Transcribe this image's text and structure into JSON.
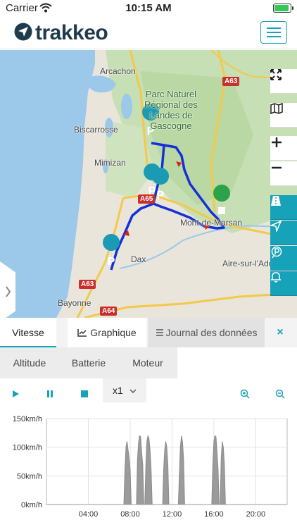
{
  "status_bar": {
    "carrier": "Carrier",
    "time": "10:15 AM"
  },
  "header": {
    "brand": "trakkeo"
  },
  "map": {
    "labels": {
      "arcachon": "Arcachon",
      "parc": "Parc Naturel\nRégional des\nLandes de\nGascogne",
      "biscarrosse": "Biscarrosse",
      "mimizan": "Mimizan",
      "mont_de_marsan": "Mont-de-Marsan",
      "dax": "Dax",
      "aire": "Aire-sur-l'Adour",
      "bayonne": "Bayonne"
    },
    "roads": {
      "a63_top": "A63",
      "a65": "A65",
      "a63_bottom": "A63",
      "a64": "A64"
    },
    "marker_label": "P"
  },
  "tabs": {
    "speed": "Vitesse",
    "chart": "Graphique",
    "log": "Journal des données",
    "close": "×"
  },
  "subtabs": {
    "altitude": "Altitude",
    "battery": "Batterie",
    "engine": "Moteur"
  },
  "playback": {
    "speed": "x1"
  },
  "chart_data": {
    "type": "area",
    "title": "",
    "xlabel": "",
    "ylabel": "",
    "y_ticks": [
      "0km/h",
      "50km/h",
      "100km/h",
      "150km/h"
    ],
    "ylim": [
      0,
      150
    ],
    "x_ticks": [
      "04:00",
      "08:00",
      "12:00",
      "16:00",
      "20:00"
    ],
    "xlim": [
      0,
      23
    ],
    "grid": true,
    "series": [
      {
        "color": "#8a8a8a",
        "points": [
          [
            7.4,
            0
          ],
          [
            7.5,
            60
          ],
          [
            7.6,
            100
          ],
          [
            7.7,
            110
          ],
          [
            7.8,
            95
          ],
          [
            7.9,
            80
          ],
          [
            8.0,
            60
          ],
          [
            8.1,
            0
          ],
          [
            8.6,
            0
          ],
          [
            8.7,
            80
          ],
          [
            8.8,
            108
          ],
          [
            8.9,
            120
          ],
          [
            9.0,
            118
          ],
          [
            9.1,
            90
          ],
          [
            9.2,
            70
          ],
          [
            9.3,
            0
          ],
          [
            9.4,
            0
          ],
          [
            9.5,
            70
          ],
          [
            9.6,
            110
          ],
          [
            9.7,
            120
          ],
          [
            9.8,
            115
          ],
          [
            9.9,
            95
          ],
          [
            10.0,
            60
          ],
          [
            10.1,
            0
          ],
          [
            11.1,
            0
          ],
          [
            11.2,
            60
          ],
          [
            11.3,
            95
          ],
          [
            11.4,
            110
          ],
          [
            11.5,
            100
          ],
          [
            11.6,
            70
          ],
          [
            11.7,
            0
          ],
          [
            12.6,
            0
          ],
          [
            12.7,
            50
          ],
          [
            12.8,
            100
          ],
          [
            12.9,
            120
          ],
          [
            13.0,
            110
          ],
          [
            13.1,
            80
          ],
          [
            13.2,
            0
          ],
          [
            15.8,
            0
          ],
          [
            15.9,
            70
          ],
          [
            16.0,
            110
          ],
          [
            16.1,
            120
          ],
          [
            16.2,
            118
          ],
          [
            16.3,
            90
          ],
          [
            16.4,
            60
          ],
          [
            16.5,
            0
          ],
          [
            16.6,
            0
          ],
          [
            16.7,
            80
          ],
          [
            16.8,
            110
          ],
          [
            16.9,
            100
          ],
          [
            17.0,
            70
          ],
          [
            17.1,
            0
          ]
        ]
      }
    ]
  }
}
